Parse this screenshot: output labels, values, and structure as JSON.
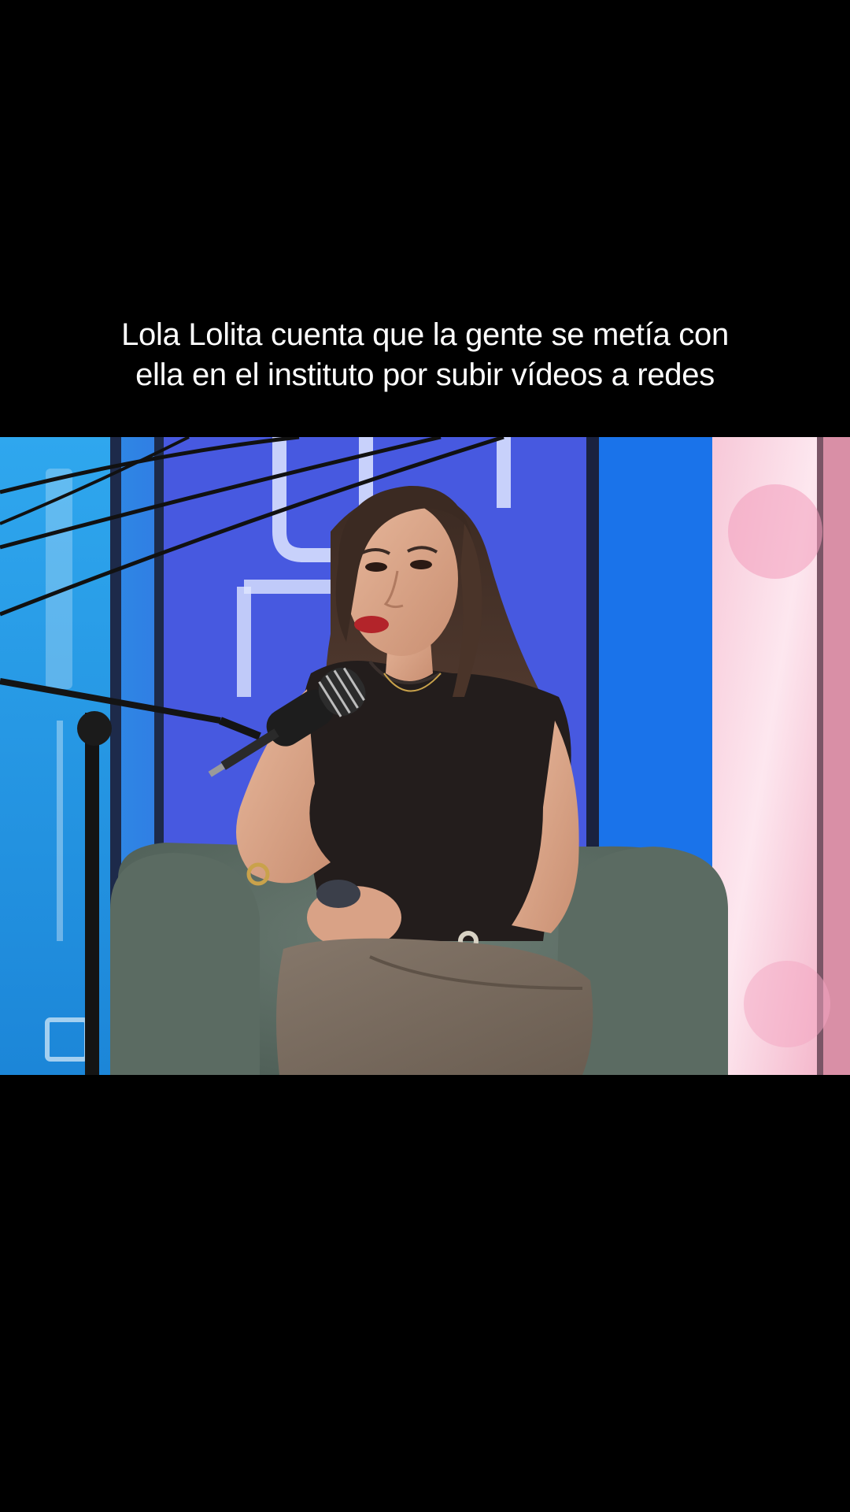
{
  "caption": {
    "line1": "Lola Lolita cuenta que la gente se metía con",
    "line2": "ella en el instituto por subir vídeos a redes"
  },
  "video": {
    "scene": "interview-frame"
  },
  "colors": {
    "background": "#000000",
    "caption_text": "#ffffff",
    "backdrop_blue": "#2f6ff0",
    "armchair": "#5f7068",
    "top": "#231d1c",
    "trousers": "#7a6b5e"
  }
}
